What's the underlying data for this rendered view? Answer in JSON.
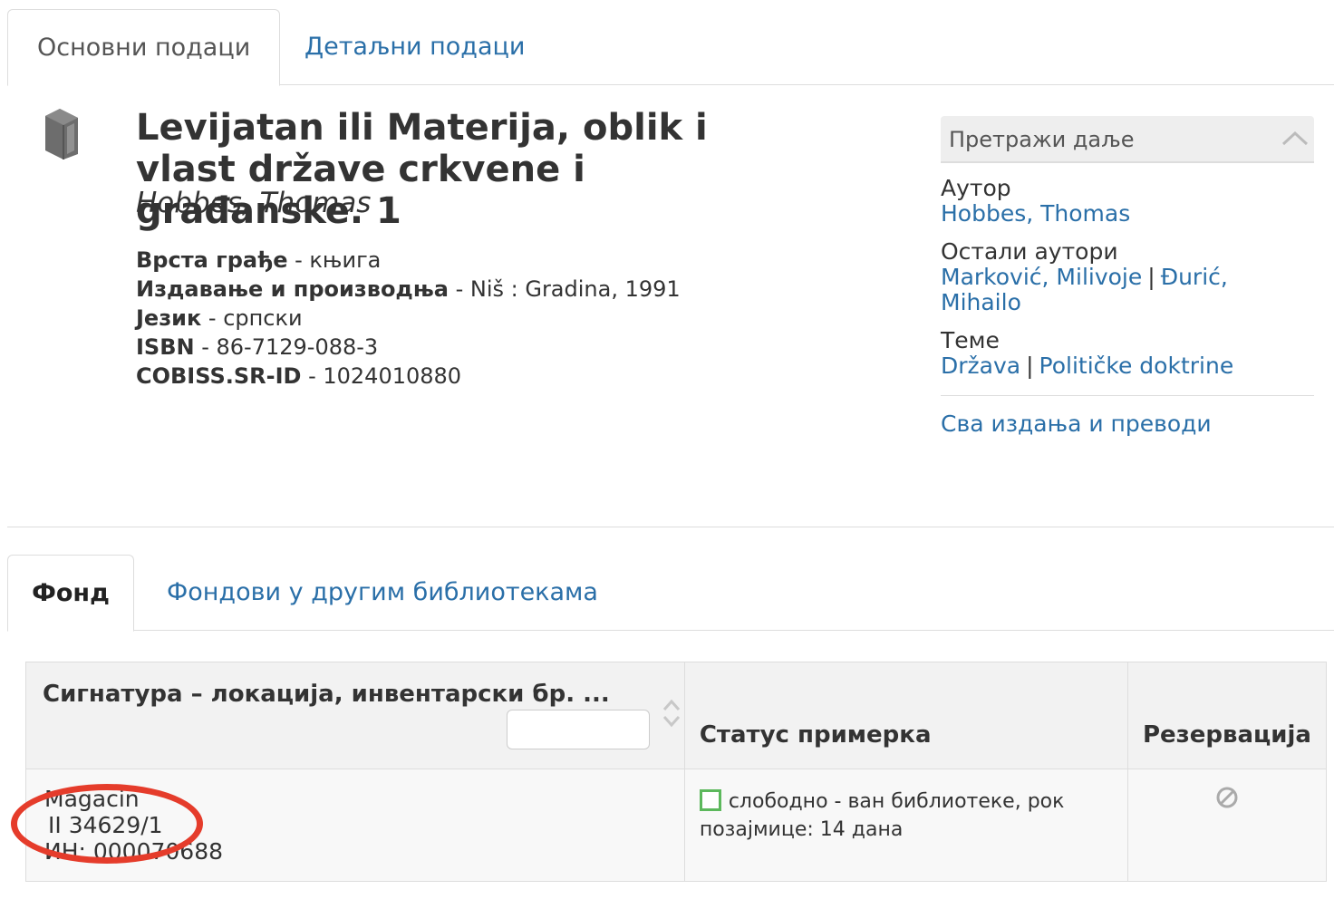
{
  "tabs_top": {
    "basic": "Основни подаци",
    "detailed": "Детаљни подаци"
  },
  "record": {
    "icon": "book-icon",
    "title": "Levijatan ili Materija, oblik i vlast države crkvene i građanske. 1",
    "author": "Hobbes, Thomas",
    "fields": [
      {
        "label": "Врста грађе",
        "value": "књига"
      },
      {
        "label": "Издавање и производња",
        "value": "Niš : Gradina, 1991"
      },
      {
        "label": "Језик",
        "value": "српски"
      },
      {
        "label": "ISBN",
        "value": "86-7129-088-3"
      },
      {
        "label": "COBISS.SR-ID",
        "value": "1024010880"
      }
    ],
    "separator": " - "
  },
  "panel": {
    "title": "Претражи даље",
    "author_label": "Аутор",
    "author_link": "Hobbes, Thomas",
    "other_authors_label": "Остали аутори",
    "other_authors": [
      "Marković, Milivoje",
      "Đurić, Mihailo"
    ],
    "subjects_label": "Теме",
    "subjects": [
      "Država",
      "Političke doktrine"
    ],
    "pipe": "|",
    "all_editions": "Сва издања и преводи"
  },
  "tabs_holdings": {
    "holdings": "Фонд",
    "other_libraries": "Фондови у другим библиотекама"
  },
  "table": {
    "headers": {
      "call_number": "Сигнатура – локација, инвентарски бр. ...",
      "status": "Статус примерка",
      "reservation": "Резервација"
    },
    "row": {
      "location": "Magacin",
      "call_number": "II 34629/1",
      "inventory": "ИН: 000070688",
      "status": "слободно - ван библиотеке, рок позајмице: 14 дана",
      "status_color": "#5cb85c",
      "reservation_icon": "not-available-icon"
    }
  },
  "annotation_color": "#e53c2b"
}
